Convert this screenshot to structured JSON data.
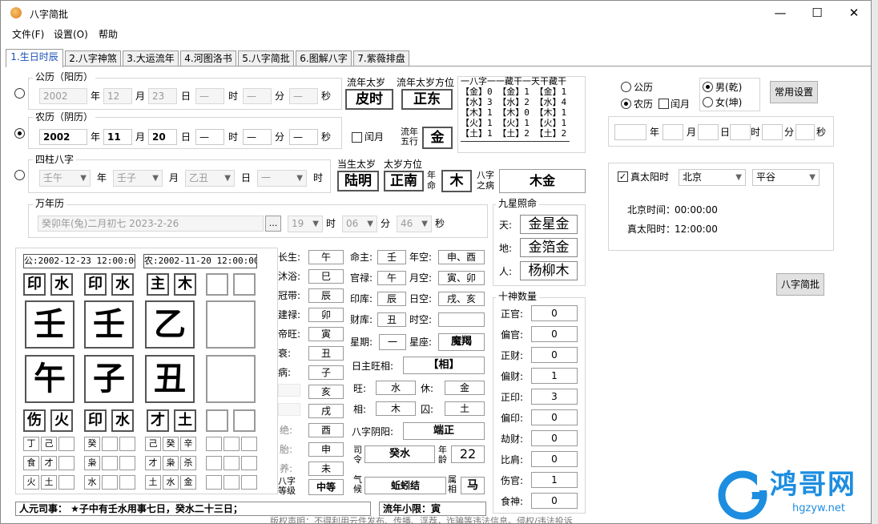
{
  "app": {
    "title": "八字简批"
  },
  "menu": [
    "文件(F)",
    "设置(O)",
    "帮助"
  ],
  "tabs": [
    "1.生日时辰",
    "2.八字神煞",
    "3.大运流年",
    "4.河图洛书",
    "5.八字简批",
    "6.图解八字",
    "7.紫薇排盘"
  ],
  "gregorian": {
    "group": "公历（阳历）",
    "year": "2002",
    "year_l": "年",
    "month": "12",
    "month_l": "月",
    "day": "23",
    "day_l": "日",
    "hour": "—",
    "hour_l": "时",
    "minute": "—",
    "minute_l": "分",
    "second": "—",
    "second_l": "秒"
  },
  "lunar": {
    "group": "农历（阴历）",
    "year": "2002",
    "year_l": "年",
    "month": "11",
    "month_l": "月",
    "day": "20",
    "day_l": "日",
    "hour": "—",
    "hour_l": "时",
    "minute": "—",
    "minute_l": "分",
    "second": "—",
    "second_l": "秒",
    "leap": "闰月"
  },
  "pillars": {
    "group": "四柱八字",
    "year": "壬午",
    "year_l": "年",
    "month": "壬子",
    "month_l": "月",
    "day": "乙丑",
    "day_l": "日",
    "hour": "一",
    "hour_l": "时"
  },
  "calendar": {
    "group": "万年历",
    "date": "癸卯年(兔)二月初七  2023-2-26",
    "browse": "...",
    "hour": "19",
    "hour_l": "时",
    "minute": "06",
    "minute_l": "分",
    "second": "46",
    "second_l": "秒"
  },
  "taisui": {
    "liunian_l": "流年太岁",
    "liunian": "皮时",
    "fangwei_l": "流年太岁方位",
    "fangwei": "正东",
    "wuxing_l1": "流年",
    "wuxing_l2": "五行",
    "wuxing": "金",
    "dangsheng_l": "当生太岁",
    "dangsheng": "陆明",
    "dangfang_l": "太岁方位",
    "dangfang": "正南",
    "nianming_l1": "年",
    "nianming_l2": "命",
    "nianming": "木",
    "bing_l1": "八字",
    "bing_l2": "之病",
    "bing": "木金"
  },
  "canggan": {
    "headers": "一八字一一藏干一天干藏干",
    "rows": [
      "【金】0 【金】1 【金】1",
      "【水】3 【水】2 【水】4",
      "【木】1 【木】0 【木】1",
      "【火】1 【火】1 【火】1",
      "【土】1 【土】2 【土】2"
    ]
  },
  "gender": {
    "gregorian": "公历",
    "lunar": "农历",
    "leap": "闰月",
    "male": "男(乾)",
    "female": "女(坤)",
    "common": "常用设置"
  },
  "dt_fields": {
    "year_l": "年",
    "month_l": "月",
    "day_l": "日",
    "hour_l": "时",
    "minute_l": "分",
    "second_l": "秒"
  },
  "solar": {
    "check": "真太阳时",
    "city": "北京",
    "district": "平谷",
    "beijing_l": "北京时间：",
    "beijing": "00:00:00",
    "true_l": "真太阳时：",
    "true": "12:00:00"
  },
  "jianpi_btn": "八字简批",
  "chart": {
    "gong": "公:2002-12-23 12:00:00",
    "nong": "农:2002-11-20 12:00:00",
    "shishen_top": [
      "印",
      "水",
      "印",
      "水",
      "主",
      "木"
    ],
    "stems": [
      "壬",
      "壬",
      "乙"
    ],
    "branches": [
      "午",
      "子",
      "丑"
    ],
    "shishen_bot": [
      "伤",
      "火",
      "印",
      "水",
      "才",
      "土"
    ],
    "hidden": [
      [
        "丁",
        "己",
        ""
      ],
      [
        "癸",
        "",
        ""
      ],
      [
        "己",
        "癸",
        "辛"
      ],
      [
        "",
        "",
        ""
      ]
    ],
    "hidden2": [
      [
        "食",
        "才",
        ""
      ],
      [
        "枭",
        "",
        ""
      ],
      [
        "才",
        "枭",
        "杀"
      ],
      [
        "",
        "",
        ""
      ]
    ],
    "hidden3": [
      [
        "火",
        "土",
        ""
      ],
      [
        "水",
        "",
        ""
      ],
      [
        "土",
        "水",
        "金"
      ],
      [
        "",
        "",
        ""
      ]
    ]
  },
  "stages": [
    {
      "l": "长生:",
      "v": "午"
    },
    {
      "l": "沐浴:",
      "v": "巳"
    },
    {
      "l": "冠带:",
      "v": "辰"
    },
    {
      "l": "建禄:",
      "v": "卯"
    },
    {
      "l": "帝旺:",
      "v": "寅"
    },
    {
      "l": "衰:",
      "v": "丑"
    },
    {
      "l": "病:",
      "v": "子"
    },
    {
      "l": "",
      "v": "亥"
    },
    {
      "l": "",
      "v": "戌"
    },
    {
      "l": "绝:",
      "v": "酉"
    },
    {
      "l": "胎:",
      "v": "申"
    },
    {
      "l": "养:",
      "v": "未"
    }
  ],
  "grade": {
    "l1": "八字",
    "l2": "等级",
    "v": "中等"
  },
  "palace": {
    "ming_l": "命主:",
    "ming": "壬",
    "guan_l": "官禄:",
    "guan": "午",
    "yin_l": "印库:",
    "yin": "辰",
    "cai_l": "财库:",
    "cai": "丑",
    "week_l": "星期:",
    "week": "一",
    "star_l": "星座:",
    "star": "魔羯",
    "nk_l": "年空:",
    "nk": "申、酉",
    "yk_l": "月空:",
    "yk": "寅、卯",
    "rk_l": "日空:",
    "rk": "戌、亥",
    "sk_l": "时空:",
    "sk": ""
  },
  "zhu": {
    "label": "日主旺相:",
    "value": "【相】",
    "wang_l": "旺:",
    "wang": "水",
    "xiu_l": "休:",
    "xiu": "金",
    "xiang_l": "相:",
    "xiang": "木",
    "qiu_l": "囚:",
    "qiu": "土",
    "yy_l": "八字阴阳:",
    "yy": "端正",
    "sl_l1": "司",
    "sl_l2": "令",
    "sl": "癸水",
    "age_l1": "年",
    "age_l2": "龄",
    "age": "22",
    "qh_l1": "气",
    "qh_l2": "候",
    "qh": "蚯蚓结",
    "sx_l1": "属",
    "sx_l2": "相",
    "sx": "马"
  },
  "jiuxing": {
    "title": "九星照命",
    "tian_l": "天:",
    "tian": "金星金",
    "di_l": "地:",
    "di": "金箔金",
    "ren_l": "人:",
    "ren": "杨柳木"
  },
  "shishen": {
    "title": "十神数量",
    "items": [
      {
        "l": "正官:",
        "v": "0"
      },
      {
        "l": "偏官:",
        "v": "0"
      },
      {
        "l": "正财:",
        "v": "0"
      },
      {
        "l": "偏财:",
        "v": "1"
      },
      {
        "l": "正印:",
        "v": "3"
      },
      {
        "l": "偏印:",
        "v": "0"
      },
      {
        "l": "劫财:",
        "v": "0"
      },
      {
        "l": "比肩:",
        "v": "0"
      },
      {
        "l": "伤官:",
        "v": "1"
      },
      {
        "l": "食神:",
        "v": "0"
      }
    ]
  },
  "status": {
    "renyuan": "人元司事：    ★子中有壬水用事七日，癸水二十三日；",
    "xiaoxian": "流年小限：寅"
  },
  "footer": "版权声明：不得利用云件发布、传播、浮荐，诈骗等违法信息。侵权/违法投诉",
  "watermark": {
    "text": "鸿哥网",
    "url": "hgzyw.net"
  }
}
